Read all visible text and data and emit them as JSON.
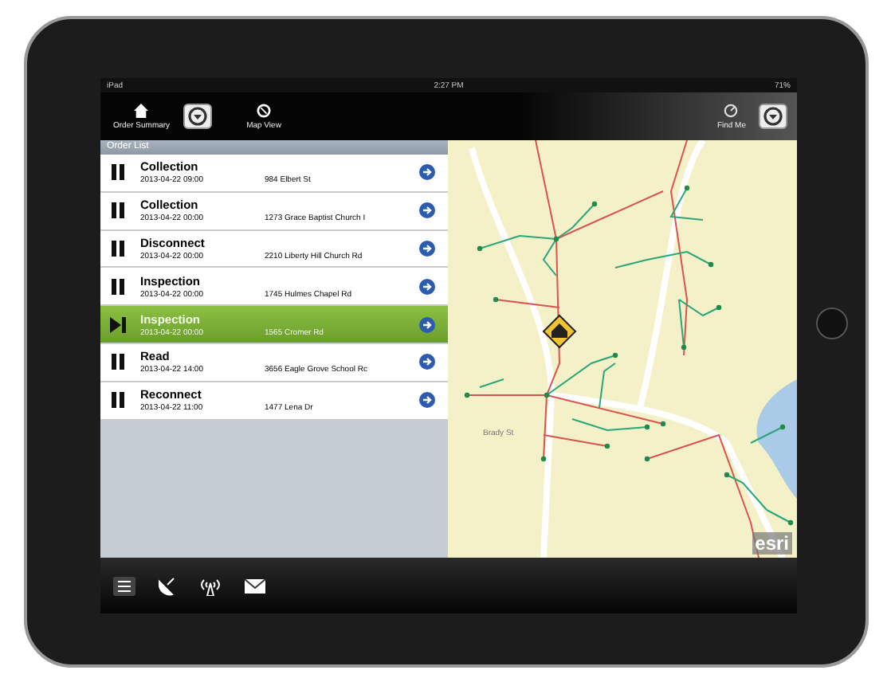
{
  "status_bar": {
    "device": "iPad",
    "time": "2:27 PM",
    "battery": "71%"
  },
  "toolbar": {
    "left_button": "Order Summary",
    "map_button": "Map View",
    "find_button": "Find Me"
  },
  "order_list": {
    "title": "Order List",
    "rows": [
      {
        "type": "Collection",
        "date": "2013-04-22 09:00",
        "address": "984 Elbert St",
        "selected": false
      },
      {
        "type": "Collection",
        "date": "2013-04-22 00:00",
        "address": "1273 Grace Baptist Church I",
        "selected": false
      },
      {
        "type": "Disconnect",
        "date": "2013-04-22 00:00",
        "address": "2210 Liberty Hill Church Rd",
        "selected": false
      },
      {
        "type": "Inspection",
        "date": "2013-04-22 00:00",
        "address": "1745 Hulmes Chapel Rd",
        "selected": false
      },
      {
        "type": "Inspection",
        "date": "2013-04-22 00:00",
        "address": "1565 Cromer Rd",
        "selected": true
      },
      {
        "type": "Read",
        "date": "2013-04-22 14:00",
        "address": "3656 Eagle Grove School Rc",
        "selected": false
      },
      {
        "type": "Reconnect",
        "date": "2013-04-22 11:00",
        "address": "1477 Lena Dr",
        "selected": false
      }
    ]
  },
  "map": {
    "road_label": "Brady St",
    "logo": "esri"
  }
}
